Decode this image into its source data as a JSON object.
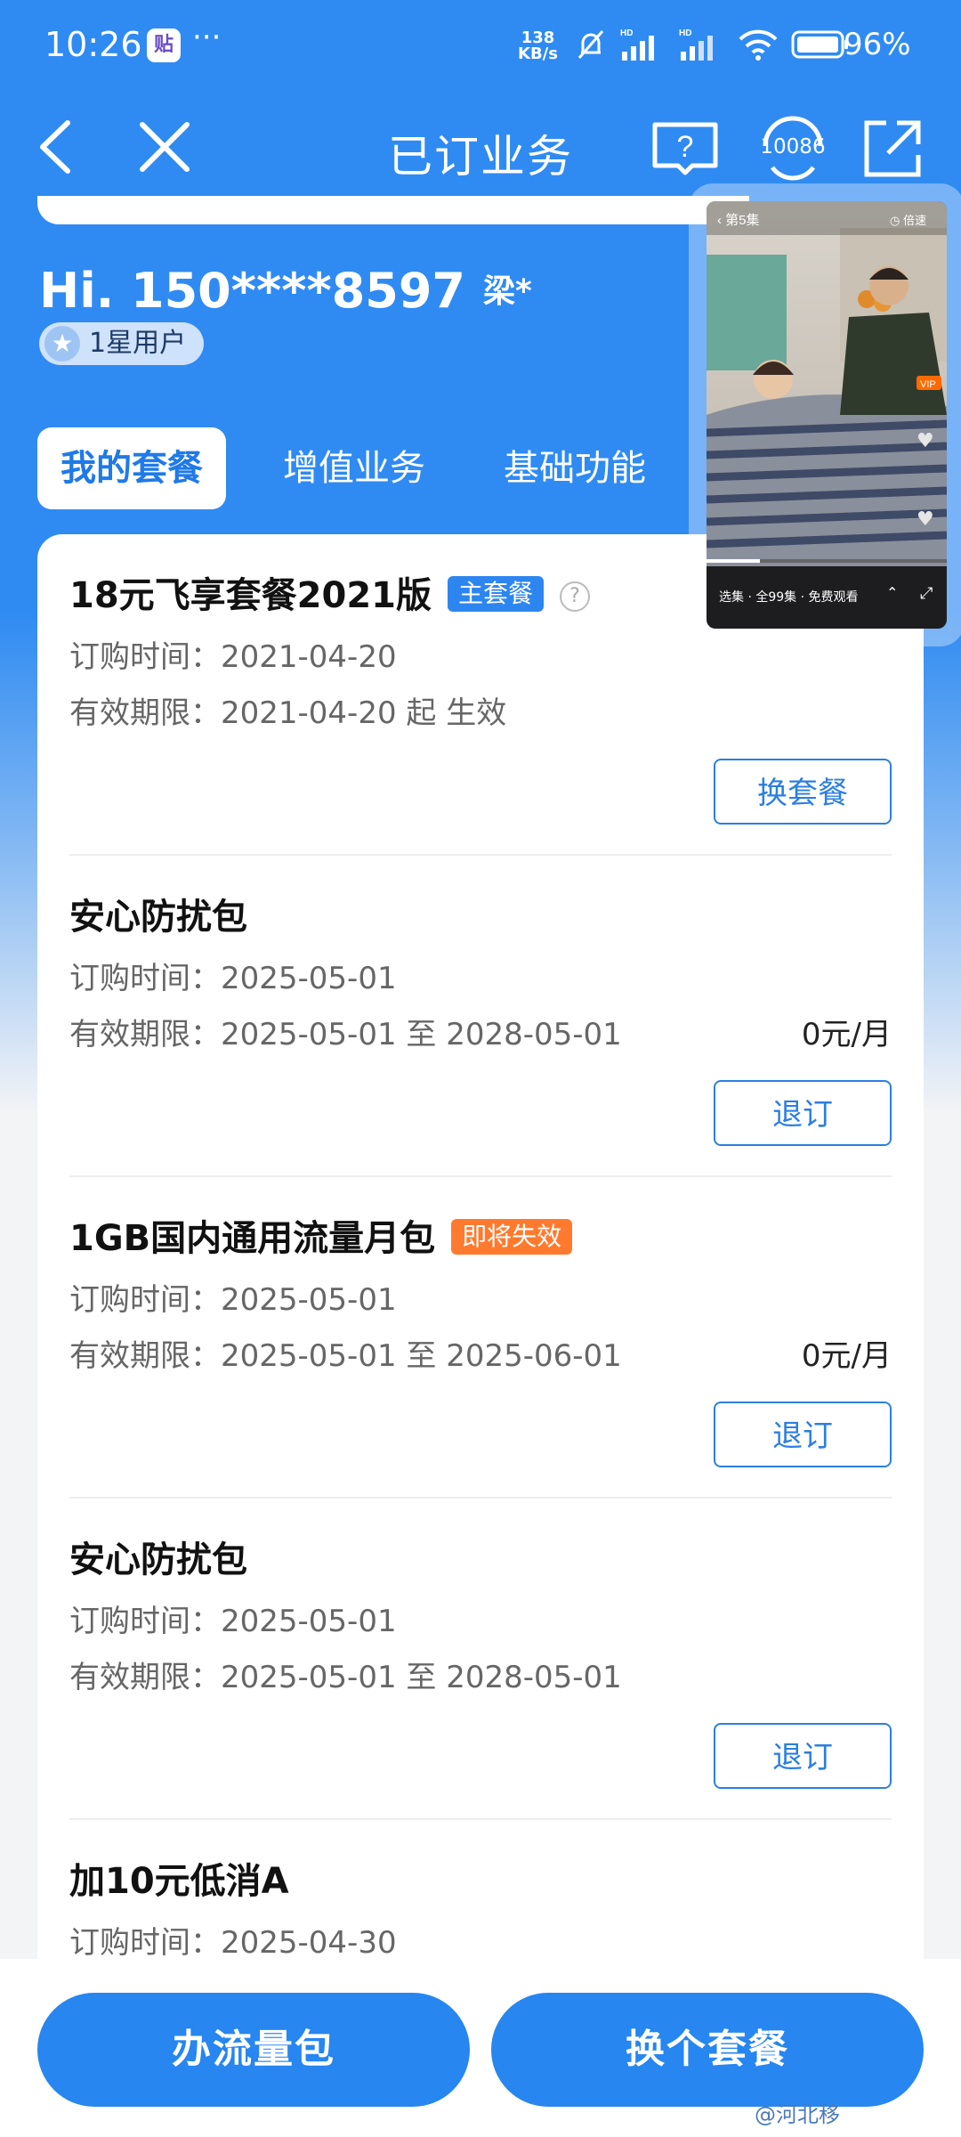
{
  "status_bar": {
    "time": "10:26",
    "app_badge": "贴",
    "more": "···",
    "net_speed_value": "138",
    "net_speed_unit": "KB/s",
    "battery": "96%"
  },
  "nav": {
    "title": "已订业务",
    "hotline": "10086"
  },
  "user": {
    "greeting": "Hi. 150****8597",
    "surname": "梁*",
    "level": "1星用户"
  },
  "tabs": [
    {
      "label": "我的套餐",
      "active": true
    },
    {
      "label": "增值业务",
      "active": false
    },
    {
      "label": "基础功能",
      "active": false
    }
  ],
  "packages": [
    {
      "name": "18元飞享套餐2021版",
      "tag": "主套餐",
      "tag_color": "#2d86f0",
      "help": "?",
      "order_time": "订购时间：2021-04-20",
      "validity": "有效期限：2021-04-20 起 生效",
      "price": "",
      "action": "换套餐"
    },
    {
      "name": "安心防扰包",
      "tag": "",
      "order_time": "订购时间：2025-05-01",
      "validity": "有效期限：2025-05-01 至 2028-05-01",
      "price": "0元/月",
      "action": "退订"
    },
    {
      "name": "1GB国内通用流量月包",
      "tag": "即将失效",
      "tag_color": "#ff7a2e",
      "order_time": "订购时间：2025-05-01",
      "validity": "有效期限：2025-05-01 至 2025-06-01",
      "price": "0元/月",
      "action": "退订"
    },
    {
      "name": "安心防扰包",
      "tag": "",
      "order_time": "订购时间：2025-05-01",
      "validity": "有效期限：2025-05-01 至 2028-05-01",
      "price": "",
      "action": "退订"
    },
    {
      "name": "加10元低消A",
      "tag": "",
      "order_time": "订购时间：2025-04-30",
      "validity": "",
      "price": "",
      "action": ""
    }
  ],
  "video": {
    "episode": "第5集",
    "speed": "倍速",
    "badge": "VIP",
    "bottom_left": "选集 · 全99集 · 免费观看"
  },
  "bottom": {
    "left_button": "办流量包",
    "right_button": "换个套餐"
  },
  "watermark": "@河北移"
}
